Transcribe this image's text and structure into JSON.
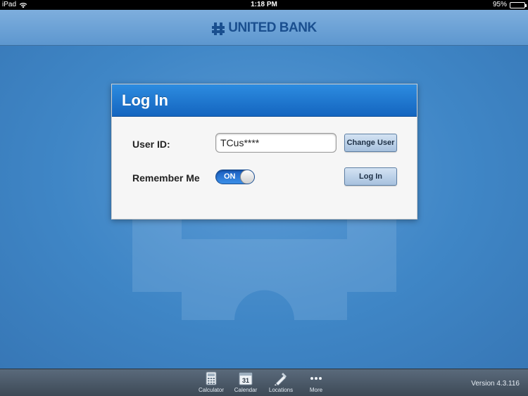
{
  "status_bar": {
    "device": "iPad",
    "time": "1:18 PM",
    "battery": "95%",
    "battery_level": 0.95
  },
  "header": {
    "brand": "UNITED BANK"
  },
  "login": {
    "title": "Log In",
    "user_id_label": "User ID:",
    "user_id_value": "TCus****",
    "change_user_label": "Change User",
    "remember_label": "Remember Me",
    "remember_toggle": "ON",
    "login_button": "Log In"
  },
  "tab_bar": {
    "items": [
      {
        "label": "Calculator",
        "icon": "calculator-icon"
      },
      {
        "label": "Calendar",
        "icon": "calendar-icon",
        "icon_text": "31"
      },
      {
        "label": "Locations",
        "icon": "locations-icon"
      },
      {
        "label": "More",
        "icon": "more-icon"
      }
    ],
    "version": "Version 4.3.116"
  },
  "colors": {
    "brand": "#1a4f8f",
    "panel_header": "#1e78d4",
    "background": "#3f86c6",
    "tab_bar": "#4a5765"
  }
}
